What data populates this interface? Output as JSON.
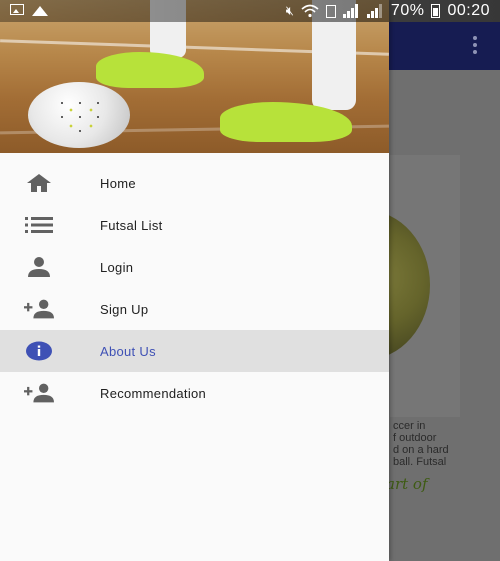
{
  "status_bar": {
    "battery_percent": "70%",
    "time": "00:20",
    "icons": [
      "image-icon",
      "photo-icon",
      "mute-icon",
      "wifi-icon",
      "sim-icon",
      "signal-icon",
      "signal-icon",
      "battery-icon"
    ]
  },
  "drawer": {
    "header_image": "futsal-player-with-ball",
    "items": [
      {
        "label": "Home",
        "icon": "home-icon",
        "active": false
      },
      {
        "label": "Futsal List",
        "icon": "list-icon",
        "active": false
      },
      {
        "label": "Login",
        "icon": "person-icon",
        "active": false
      },
      {
        "label": "Sign Up",
        "icon": "add-person-icon",
        "active": false
      },
      {
        "label": "About Us",
        "icon": "info-icon",
        "active": true
      },
      {
        "label": "Recommendation",
        "icon": "add-person-icon",
        "active": false
      }
    ]
  },
  "background": {
    "text_lines": [
      "ccer in",
      "f outdoor",
      "d on a hard",
      "ball. Futsal"
    ],
    "italic_text": "art of"
  },
  "colors": {
    "app_bar": "#161c52",
    "accent": "#3f51b5",
    "icon_gray": "#616161"
  }
}
